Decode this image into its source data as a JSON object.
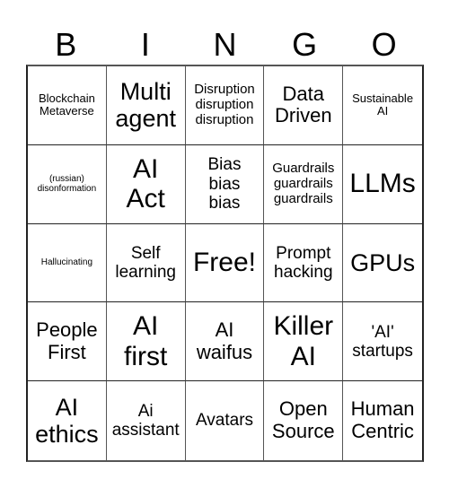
{
  "header": {
    "letters": [
      "B",
      "I",
      "N",
      "G",
      "O"
    ]
  },
  "board": {
    "cells": [
      {
        "text": "Blockchain\nMetaverse",
        "size": "fs-s"
      },
      {
        "text": "Multi\nagent",
        "size": "fs-xl"
      },
      {
        "text": "Disruption\ndisruption\ndisruption",
        "size": "fs-m"
      },
      {
        "text": "Data\nDriven",
        "size": "fs-l"
      },
      {
        "text": "Sustainable\nAI",
        "size": "fs-s"
      },
      {
        "text": "(russian)\ndisonformation",
        "size": "fs-xs"
      },
      {
        "text": "AI\nAct",
        "size": "fs-xxl"
      },
      {
        "text": "Bias\nbias\nbias",
        "size": "fs-ml"
      },
      {
        "text": "Guardrails\nguardrails\nguardrails",
        "size": "fs-m"
      },
      {
        "text": "LLMs",
        "size": "fs-xxl"
      },
      {
        "text": "Hallucinating",
        "size": "fs-xs"
      },
      {
        "text": "Self\nlearning",
        "size": "fs-ml"
      },
      {
        "text": "Free!",
        "size": "fs-xxl"
      },
      {
        "text": "Prompt\nhacking",
        "size": "fs-ml"
      },
      {
        "text": "GPUs",
        "size": "fs-xl"
      },
      {
        "text": "People\nFirst",
        "size": "fs-l"
      },
      {
        "text": "AI\nfirst",
        "size": "fs-xxl"
      },
      {
        "text": "AI\nwaifus",
        "size": "fs-l"
      },
      {
        "text": "Killer\nAI",
        "size": "fs-xxl"
      },
      {
        "text": "'AI'\nstartups",
        "size": "fs-ml"
      },
      {
        "text": "AI\nethics",
        "size": "fs-xl"
      },
      {
        "text": "Ai\nassistant",
        "size": "fs-ml"
      },
      {
        "text": "Avatars",
        "size": "fs-ml"
      },
      {
        "text": "Open\nSource",
        "size": "fs-l"
      },
      {
        "text": "Human\nCentric",
        "size": "fs-l"
      }
    ]
  }
}
